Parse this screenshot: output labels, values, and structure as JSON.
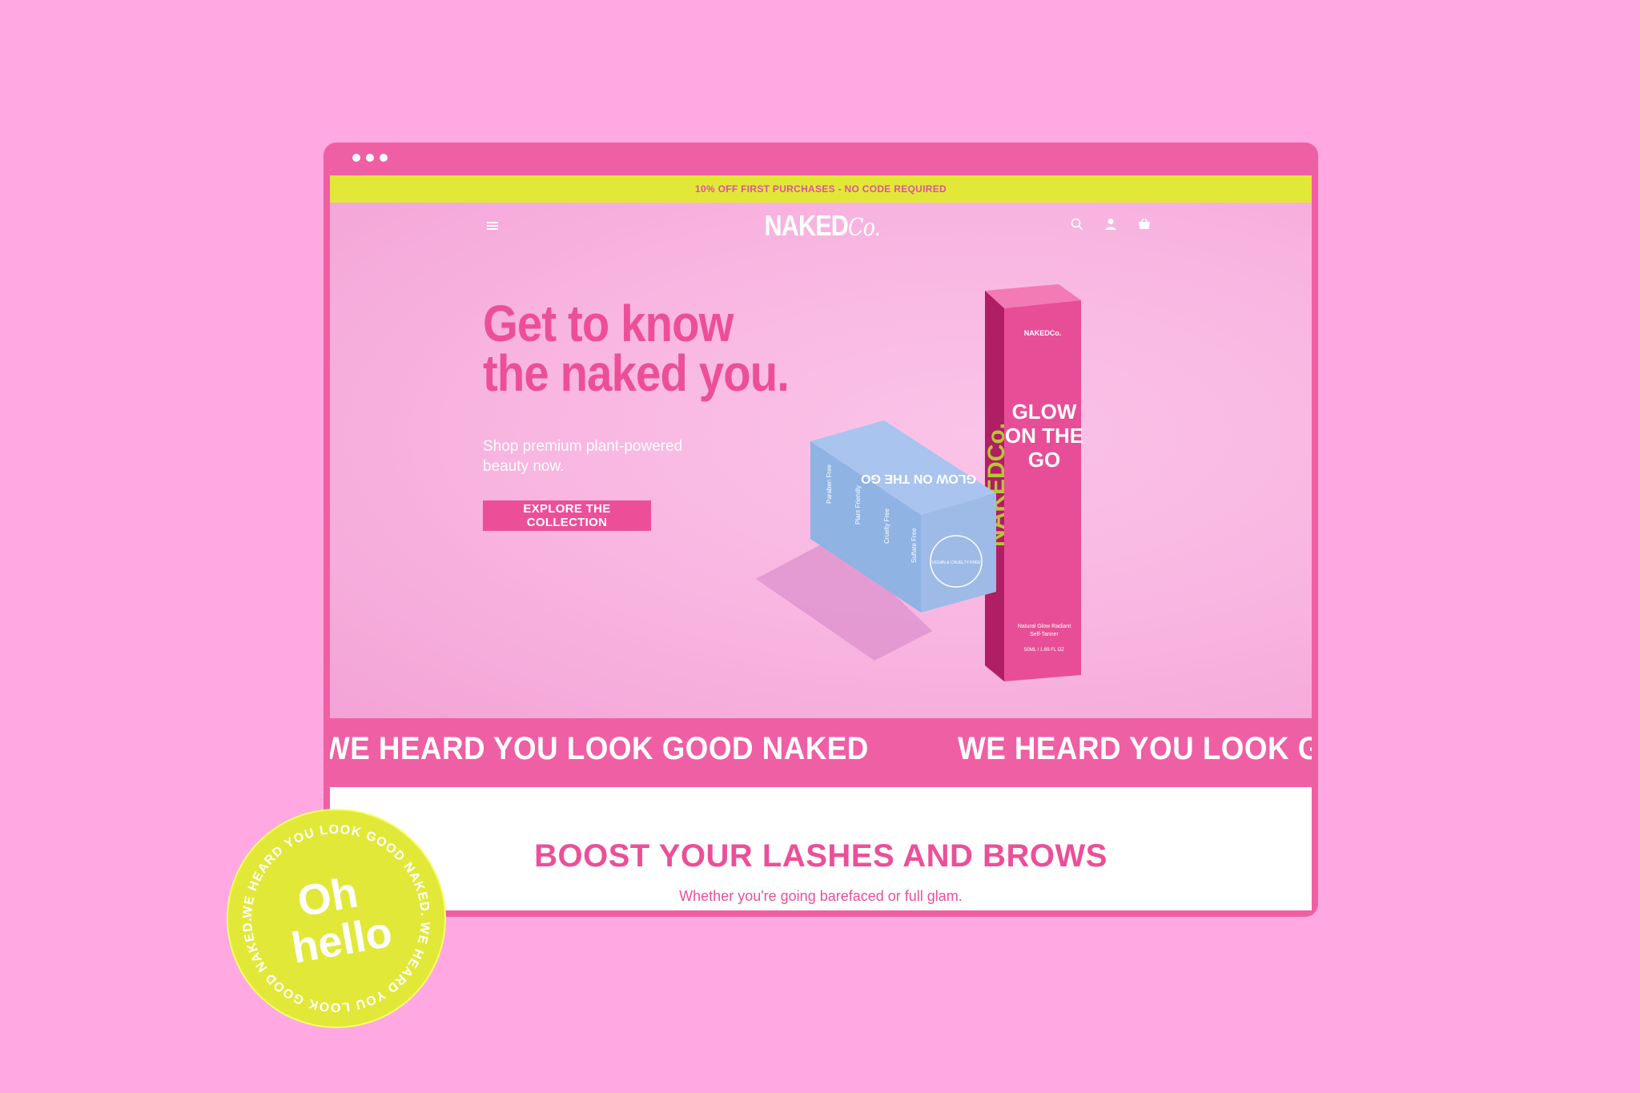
{
  "browser": {
    "window_controls": [
      "dot",
      "dot",
      "dot"
    ]
  },
  "announcement": {
    "text": "10% OFF FIRST PURCHASES - NO CODE REQUIRED"
  },
  "header": {
    "logo_main": "NAKED",
    "logo_script": "Co.",
    "icons": [
      "menu-icon",
      "search-icon",
      "account-icon",
      "cart-icon"
    ]
  },
  "hero": {
    "headline_line1": "Get to know",
    "headline_line2": "the naked you.",
    "subline": "Shop premium plant-powered beauty now.",
    "cta_label": "EXPLORE THE COLLECTION"
  },
  "product": {
    "box_brand": "NAKED",
    "box_brand_script": "Co.",
    "box_side_logo": "NAKEDCo.",
    "box_title_line1": "GLOW",
    "box_title_line2": "ON THE",
    "box_title_line3": "GO",
    "box_desc_line1": "Natural Glow Radiant",
    "box_desc_line2": "Self-Tanner",
    "box_volume": "50ML / 1.69 FL OZ",
    "blue_box_title_line1": "GLOW",
    "blue_box_title_line2": "ON THE",
    "blue_box_title_line3": "GO",
    "blue_box_seal": "VEGAN & CRUELTY FREE",
    "blue_box_features": [
      "Paraben Free",
      "Plant Friendly",
      "Cruelty Free",
      "Sulfate Free"
    ]
  },
  "ticker": {
    "text": "WE HEARD YOU LOOK GOOD NAKED"
  },
  "promo": {
    "title": "BOOST YOUR LASHES AND BROWS",
    "subtitle": "Whether you're going barefaced or full glam."
  },
  "badge": {
    "line1": "Oh",
    "line2": "hello",
    "ring_text": "WE HEARD YOU LOOK GOOD NAKED. WE HEARD YOU LOOK GOOD NAKED."
  },
  "colors": {
    "background": "#ffa8e1",
    "brand_pink": "#ec4f98",
    "frame_pink": "#ef5fa3",
    "lime": "#e2e838",
    "blue_box": "#8fb3e3",
    "magenta_box": "#e84e97"
  }
}
